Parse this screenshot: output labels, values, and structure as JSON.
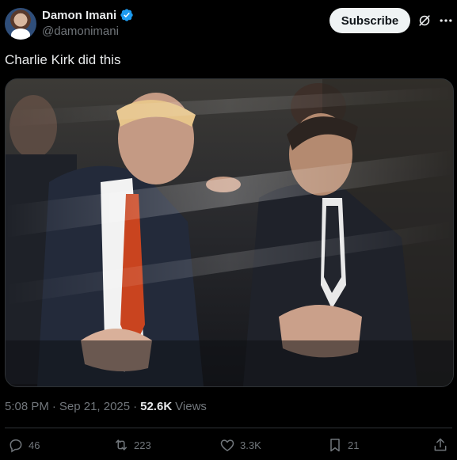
{
  "author": {
    "display_name": "Damon Imani",
    "handle": "@damonimani",
    "verified": true,
    "verified_color": "#1d9bf0"
  },
  "header": {
    "subscribe_label": "Subscribe",
    "grok_icon": "grok-icon",
    "more_icon": "more-icon"
  },
  "post": {
    "text": "Charlie Kirk did this",
    "media_description_icon": "photo"
  },
  "meta": {
    "time": "5:08 PM",
    "separator1": "·",
    "date": "Sep 21, 2025",
    "separator2": "·",
    "views_count": "52.6K",
    "views_label": "Views"
  },
  "actions": {
    "reply_count": "46",
    "repost_count": "223",
    "like_count": "3.3K",
    "bookmark_count": "21"
  },
  "colors": {
    "background": "#000000",
    "text": "#e7e9ea",
    "muted": "#71767b",
    "divider": "#2f3336",
    "subscribe_bg": "#eff3f4"
  }
}
